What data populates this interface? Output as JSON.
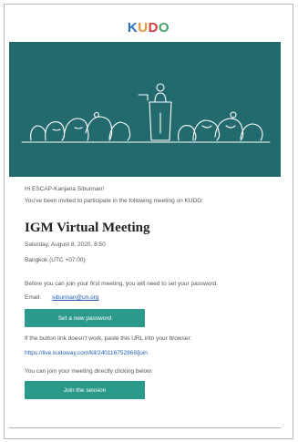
{
  "logo": {
    "letters": [
      "K",
      "U",
      "D",
      "O"
    ]
  },
  "email": {
    "greeting": "Hi ESCAP-Kanjana Sibunnan!",
    "invite_line": "You've been invited to participate in the following meeting on KUDO:",
    "meeting_title": "IGM Virtual Meeting",
    "meeting_date": "Saturday, August 8, 2020, 8:50",
    "timezone": "Bangkok (UTC +07:00)",
    "password_note": "Before you can join your first meeting, you will need to set your password.",
    "email_label": "Email:",
    "email_value": "sibunnan@un.org",
    "set_password_label": "Set a new password",
    "fallback_note": "If the button link doesn't work, paste this URL into your browser:",
    "fallback_url": "https://live.kudoway.com/kll/240116752868/join",
    "direct_note": "You can join your meeting directly clicking below:",
    "join_label": "Join the session"
  },
  "colors": {
    "hero_bg": "#236a6e",
    "button_bg": "#2b9a8a",
    "link": "#1e5fb4"
  }
}
